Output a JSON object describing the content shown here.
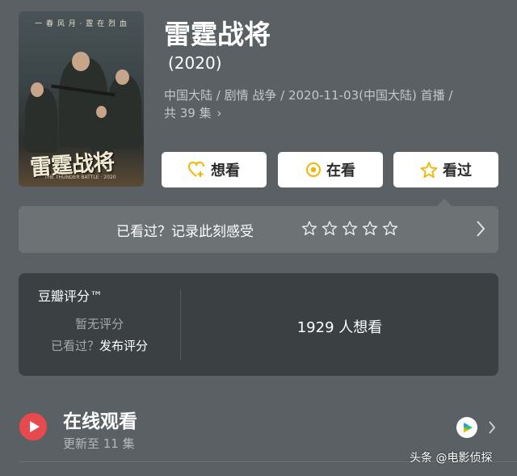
{
  "header": {
    "title": "雷霆战将",
    "year": "(2020)",
    "meta_line1": "中国大陆 / 剧情 战争 / 2020-11-03(中国大陆) 首播 /",
    "meta_line2": "共 39 集"
  },
  "poster": {
    "top_text": "一 春 风 月 · 霆 在 烈 血",
    "title_art": "雷霆战将",
    "sub_text": "THE THUNDER BATTLE · 2020"
  },
  "actions": {
    "want_label": "想看",
    "watching_label": "在看",
    "watched_label": "看过"
  },
  "record": {
    "prompt": "已看过？记录此刻感受",
    "stars": 5,
    "filled": 0
  },
  "rating": {
    "label": "豆瓣评分™",
    "none": "暂无评分",
    "seen_prefix": "已看过？",
    "publish": "发布评分",
    "want_count": "1929 人想看"
  },
  "online": {
    "title": "在线观看",
    "subtitle": "更新至 11 集"
  },
  "watermark": "头条 @电影侦探",
  "colors": {
    "background": "#5a6063",
    "accent_yellow": "#f5b400",
    "play_red": "#e8494f"
  }
}
